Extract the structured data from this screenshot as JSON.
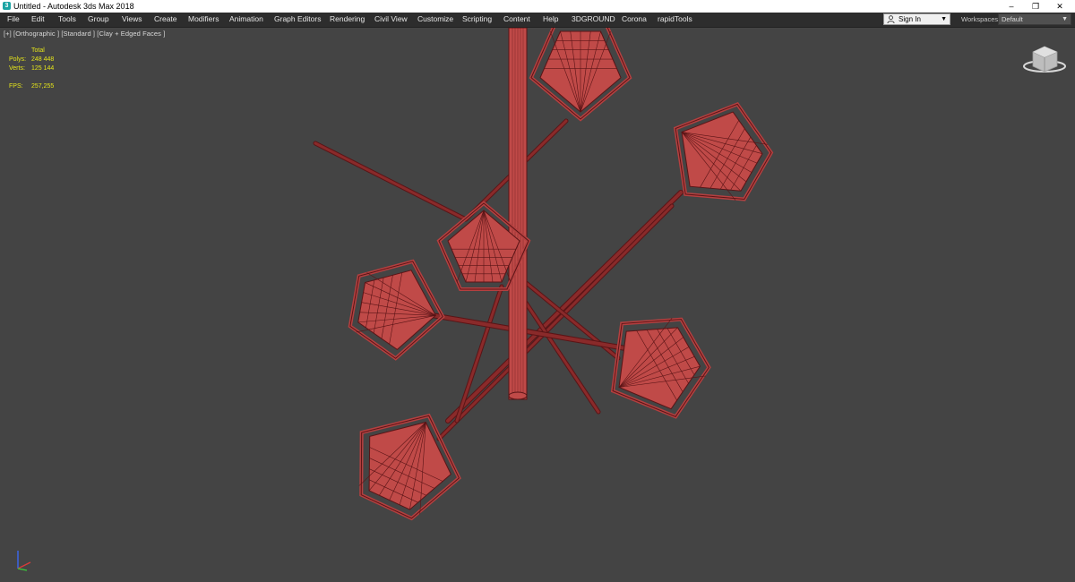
{
  "window": {
    "title": "Untitled - Autodesk 3ds Max 2018",
    "icon": "3ds-max-icon",
    "controls": {
      "minimize": "–",
      "restore": "❐",
      "close": "✕"
    }
  },
  "menu": {
    "items": [
      "File",
      "Edit",
      "Tools",
      "Group",
      "Views",
      "Create",
      "Modifiers",
      "Animation",
      "Graph Editors",
      "Rendering",
      "Civil View",
      "Customize",
      "Scripting",
      "Content",
      "Help",
      "3DGROUND",
      "Corona",
      "rapidTools"
    ]
  },
  "signin": {
    "label": "Sign In"
  },
  "workspaces": {
    "label": "Workspaces:",
    "value": "Default"
  },
  "viewport": {
    "label": "[+] [Orthographic ] [Standard ] [Clay + Edged Faces ]",
    "stats": {
      "header": "Total",
      "polys_label": "Polys:",
      "polys_value": "248 448",
      "verts_label": "Verts:",
      "verts_value": "125 144",
      "fps_label": "FPS:",
      "fps_value": "257,255"
    }
  },
  "colors": {
    "viewport_bg": "#444444",
    "model_fill": "#c04a48",
    "model_wire": "#5a1416",
    "stats_text": "#e5e51a"
  }
}
